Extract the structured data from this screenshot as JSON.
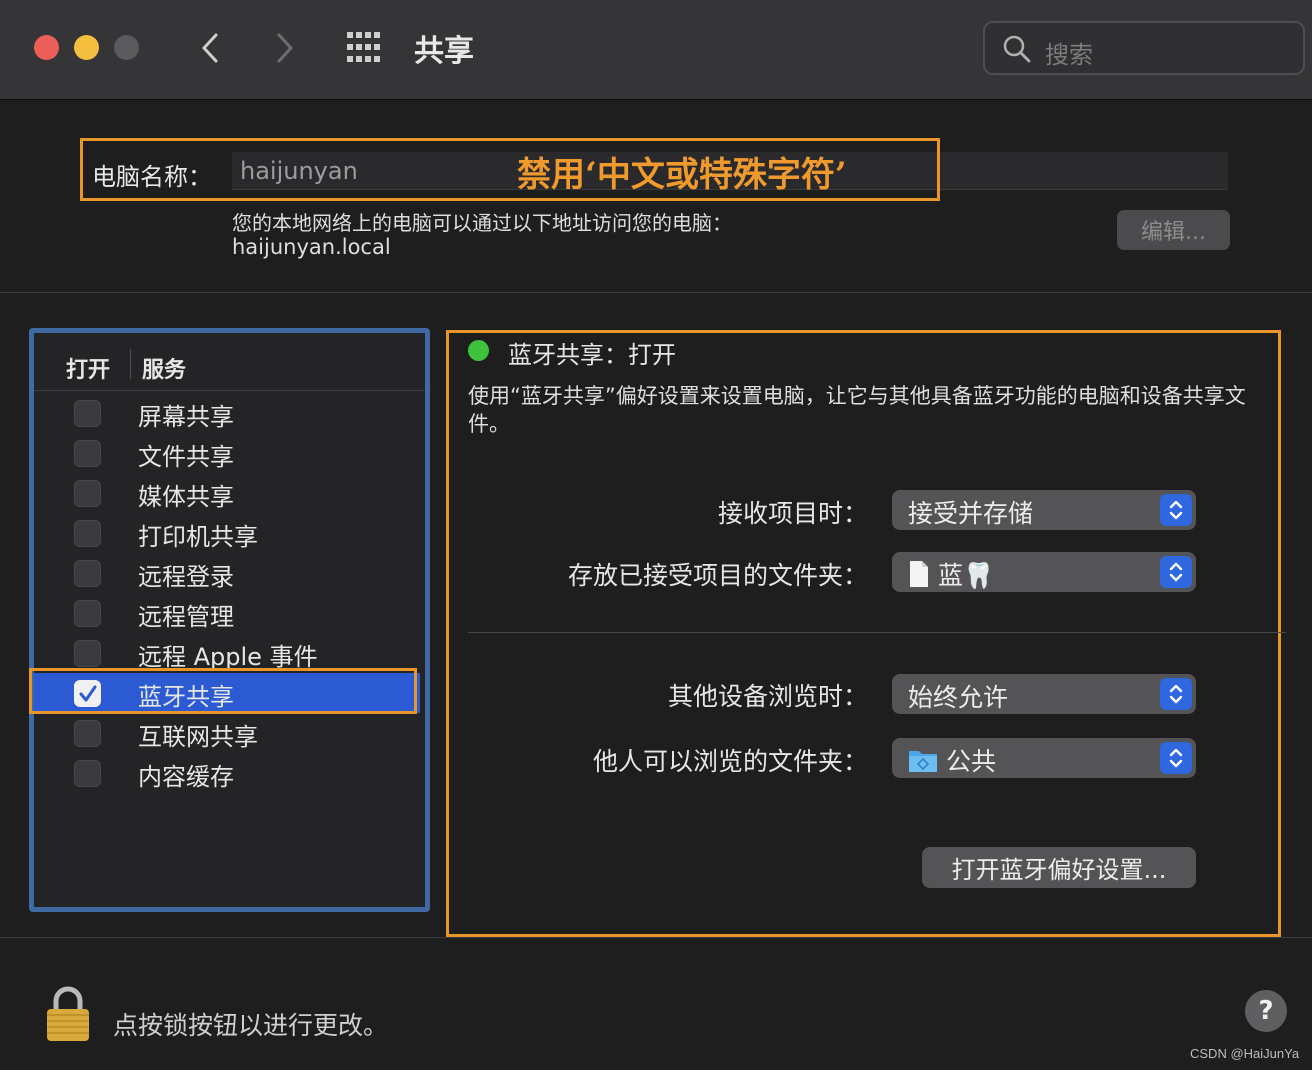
{
  "window": {
    "title": "共享",
    "search_placeholder": "搜索"
  },
  "computer_name": {
    "label": "电脑名称：",
    "value": "haijunyan",
    "annotation": "禁用‘中文或特殊字符’",
    "address_note": "您的本地网络上的电脑可以通过以下地址访问您的电脑：",
    "address": "haijunyan.local",
    "edit_button": "编辑..."
  },
  "services": {
    "header_open": "打开",
    "header_service": "服务",
    "items": [
      {
        "label": "屏幕共享",
        "checked": false
      },
      {
        "label": "文件共享",
        "checked": false
      },
      {
        "label": "媒体共享",
        "checked": false
      },
      {
        "label": "打印机共享",
        "checked": false
      },
      {
        "label": "远程登录",
        "checked": false
      },
      {
        "label": "远程管理",
        "checked": false
      },
      {
        "label": "远程 Apple 事件",
        "checked": false
      },
      {
        "label": "蓝牙共享",
        "checked": true,
        "selected": true
      },
      {
        "label": "互联网共享",
        "checked": false
      },
      {
        "label": "内容缓存",
        "checked": false
      }
    ]
  },
  "detail": {
    "status": "蓝牙共享：打开",
    "status_color": "#3ec23c",
    "description": "使用“蓝牙共享”偏好设置来设置电脑，让它与其他具备蓝牙功能的电脑和设备共享文件。",
    "receive_label": "接收项目时：",
    "receive_value": "接受并存储",
    "store_folder_label": "存放已接受项目的文件夹：",
    "store_folder_value": "蓝🦷",
    "browse_label": "其他设备浏览时：",
    "browse_value": "始终允许",
    "browse_folder_label": "他人可以浏览的文件夹：",
    "browse_folder_value": "公共",
    "open_prefs_button": "打开蓝牙偏好设置..."
  },
  "footer": {
    "lock_text": "点按锁按钮以进行更改。",
    "help": "?",
    "watermark": "CSDN @HaiJunYa"
  },
  "colors": {
    "accent_blue": "#2b5ad3",
    "annotation_orange": "#e8952a"
  }
}
